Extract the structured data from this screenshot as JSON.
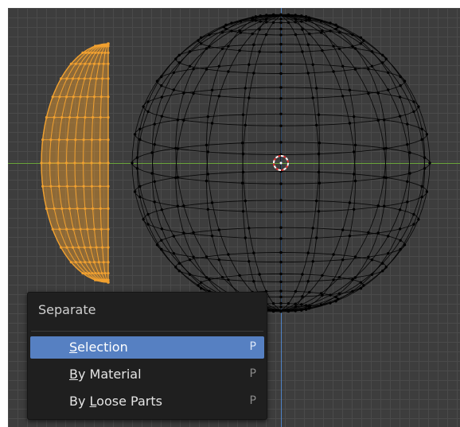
{
  "menu": {
    "title": "Separate",
    "items": [
      {
        "label": "Selection",
        "mnemonic": "S",
        "rest": "election",
        "shortcut": "P",
        "highlighted": true
      },
      {
        "label": "By Material",
        "mnemonic": "B",
        "rest": "y Material",
        "shortcut": "P",
        "highlighted": false
      },
      {
        "label": "By Loose Parts",
        "mnemonic_pre": "By ",
        "mnemonic": "L",
        "rest": "oose Parts",
        "shortcut": "P",
        "highlighted": false
      }
    ]
  },
  "colors": {
    "viewport_background": "#3d3d3d",
    "grid_line": "#4a4a4a",
    "x_axis": "#6aa53a",
    "y_axis": "#4f83c6",
    "selected_mesh": "#f0a030",
    "unselected_mesh": "#000000",
    "menu_highlight": "#5680c2"
  }
}
